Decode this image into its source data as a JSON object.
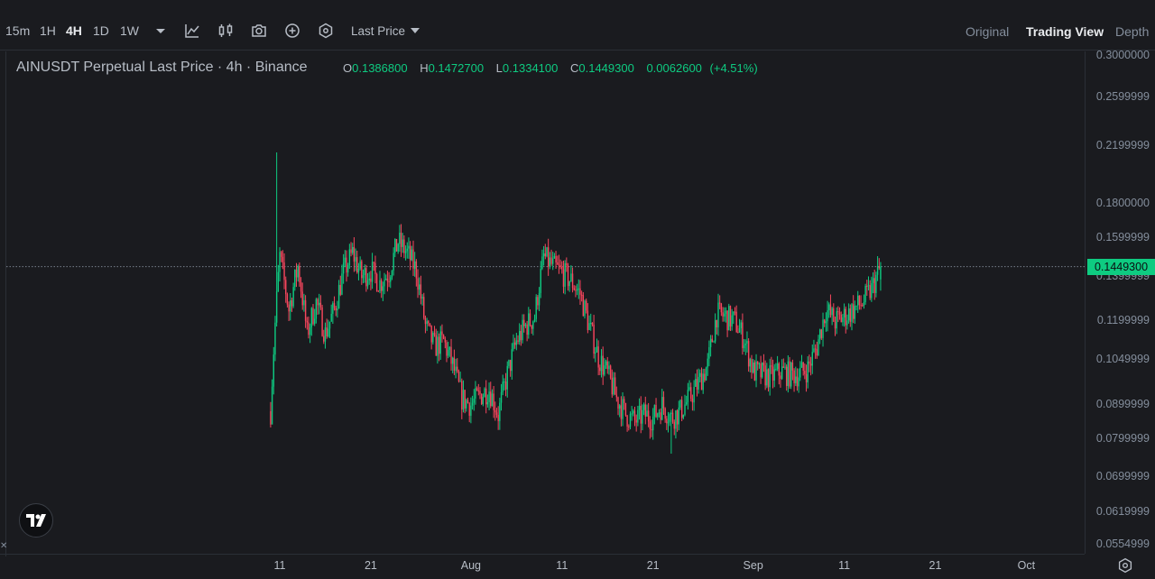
{
  "toolbar": {
    "timeframes": [
      "15m",
      "1H",
      "4H",
      "1D",
      "1W"
    ],
    "active_timeframe": "4H",
    "price_type": "Last Price",
    "views": [
      "Original",
      "Trading View",
      "Depth"
    ],
    "active_view": "Trading View",
    "icons": [
      "dropdown-caret-icon",
      "indicator-icon",
      "candle-type-icon",
      "screenshot-icon",
      "add-icon",
      "settings-hex-icon"
    ]
  },
  "legend": {
    "title": "AINUSDT Perpetual Last Price · 4h · Binance",
    "open_label": "O",
    "open": "0.1386800",
    "high_label": "H",
    "high": "0.1472700",
    "low_label": "L",
    "low": "0.1334100",
    "close_label": "C",
    "close": "0.1449300",
    "change": "0.0062600",
    "change_pct": "(+4.51%)"
  },
  "colors": {
    "up": "#0ecb81",
    "down": "#f6465d",
    "background": "#1a1b1f",
    "grid": "#2b2f36"
  },
  "chart_data": {
    "type": "candlestick",
    "symbol": "AINUSDT Perpetual",
    "interval": "4h",
    "exchange": "Binance",
    "y_scale": "log",
    "ylim": [
      0.0554999,
      0.3
    ],
    "y_ticks": [
      "0.3000000",
      "0.2599999",
      "0.2199999",
      "0.1800000",
      "0.1599999",
      "0.1399999",
      "0.1199999",
      "0.1049999",
      "0.0899999",
      "0.0799999",
      "0.0699999",
      "0.0619999",
      "0.0554999"
    ],
    "x_ticks": [
      "11",
      "21",
      "Aug",
      "11",
      "21",
      "Sep",
      "11",
      "21",
      "Oct"
    ],
    "current_price": "0.1449300",
    "close_path": [
      {
        "date": "2024-07-10",
        "close": 0.088
      },
      {
        "date": "2024-07-11",
        "close": 0.15
      },
      {
        "date": "2024-07-12",
        "close": 0.125
      },
      {
        "date": "2024-07-13",
        "close": 0.145
      },
      {
        "date": "2024-07-14",
        "close": 0.115
      },
      {
        "date": "2024-07-15",
        "close": 0.128
      },
      {
        "date": "2024-07-16",
        "close": 0.115
      },
      {
        "date": "2024-07-17",
        "close": 0.125
      },
      {
        "date": "2024-07-18",
        "close": 0.142
      },
      {
        "date": "2024-07-19",
        "close": 0.152
      },
      {
        "date": "2024-07-20",
        "close": 0.14
      },
      {
        "date": "2024-07-21",
        "close": 0.143
      },
      {
        "date": "2024-07-22",
        "close": 0.137
      },
      {
        "date": "2024-07-23",
        "close": 0.142
      },
      {
        "date": "2024-07-24",
        "close": 0.158
      },
      {
        "date": "2024-07-25",
        "close": 0.152
      },
      {
        "date": "2024-07-26",
        "close": 0.143
      },
      {
        "date": "2024-07-27",
        "close": 0.118
      },
      {
        "date": "2024-07-28",
        "close": 0.11
      },
      {
        "date": "2024-07-29",
        "close": 0.112
      },
      {
        "date": "2024-07-30",
        "close": 0.103
      },
      {
        "date": "2024-07-31",
        "close": 0.092
      },
      {
        "date": "2024-08-01",
        "close": 0.09
      },
      {
        "date": "2024-08-02",
        "close": 0.093
      },
      {
        "date": "2024-08-03",
        "close": 0.095
      },
      {
        "date": "2024-08-04",
        "close": 0.087
      },
      {
        "date": "2024-08-05",
        "close": 0.1
      },
      {
        "date": "2024-08-06",
        "close": 0.112
      },
      {
        "date": "2024-08-07",
        "close": 0.118
      },
      {
        "date": "2024-08-08",
        "close": 0.122
      },
      {
        "date": "2024-08-09",
        "close": 0.15
      },
      {
        "date": "2024-08-10",
        "close": 0.145
      },
      {
        "date": "2024-08-11",
        "close": 0.142
      },
      {
        "date": "2024-08-12",
        "close": 0.138
      },
      {
        "date": "2024-08-13",
        "close": 0.132
      },
      {
        "date": "2024-08-14",
        "close": 0.118
      },
      {
        "date": "2024-08-15",
        "close": 0.106
      },
      {
        "date": "2024-08-16",
        "close": 0.1
      },
      {
        "date": "2024-08-17",
        "close": 0.092
      },
      {
        "date": "2024-08-18",
        "close": 0.087
      },
      {
        "date": "2024-08-19",
        "close": 0.085
      },
      {
        "date": "2024-08-20",
        "close": 0.087
      },
      {
        "date": "2024-08-21",
        "close": 0.086
      },
      {
        "date": "2024-08-22",
        "close": 0.09
      },
      {
        "date": "2024-08-23",
        "close": 0.086
      },
      {
        "date": "2024-08-24",
        "close": 0.088
      },
      {
        "date": "2024-08-25",
        "close": 0.092
      },
      {
        "date": "2024-08-26",
        "close": 0.097
      },
      {
        "date": "2024-08-27",
        "close": 0.103
      },
      {
        "date": "2024-08-28",
        "close": 0.123
      },
      {
        "date": "2024-08-29",
        "close": 0.122
      },
      {
        "date": "2024-08-30",
        "close": 0.12
      },
      {
        "date": "2024-08-31",
        "close": 0.113
      },
      {
        "date": "2024-09-01",
        "close": 0.101
      },
      {
        "date": "2024-09-02",
        "close": 0.1
      },
      {
        "date": "2024-09-03",
        "close": 0.099
      },
      {
        "date": "2024-09-04",
        "close": 0.101
      },
      {
        "date": "2024-09-05",
        "close": 0.1
      },
      {
        "date": "2024-09-06",
        "close": 0.1
      },
      {
        "date": "2024-09-07",
        "close": 0.102
      },
      {
        "date": "2024-09-08",
        "close": 0.11
      },
      {
        "date": "2024-09-09",
        "close": 0.125
      },
      {
        "date": "2024-09-10",
        "close": 0.12
      },
      {
        "date": "2024-09-11",
        "close": 0.122
      },
      {
        "date": "2024-09-12",
        "close": 0.125
      },
      {
        "date": "2024-09-13",
        "close": 0.128
      },
      {
        "date": "2024-09-14",
        "close": 0.134
      },
      {
        "date": "2024-09-15",
        "close": 0.145
      }
    ]
  }
}
